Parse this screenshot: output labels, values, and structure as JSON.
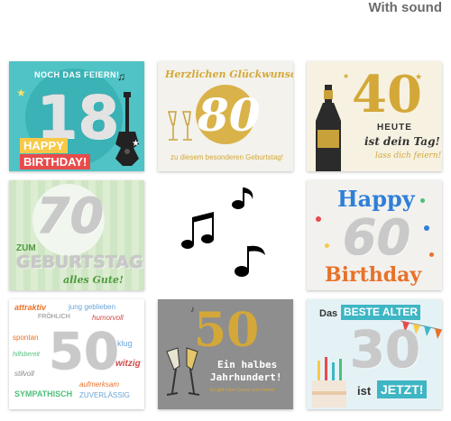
{
  "header": {
    "badge": "With sound"
  },
  "cards": [
    {
      "id": "18",
      "top": "NOCH DAS FEIERN!",
      "number": "18",
      "line1": "HAPPY",
      "line2": "BIRTHDAY!"
    },
    {
      "id": "80",
      "top": "Herzlichen Glückwunsch",
      "number": "80",
      "bottom": "zu diesem besonderen Geburtstag!"
    },
    {
      "id": "40",
      "number": "40",
      "line1": "HEUTE",
      "line2": "ist dein Tag!",
      "line3": "lass dich feiern!"
    },
    {
      "id": "70",
      "number": "70",
      "line1": "ZUM",
      "line2": "GEBURTSTAG",
      "line3": "alles Gute!"
    },
    {
      "id": "60",
      "line1": "Happy",
      "number": "60",
      "line2": "Birthday"
    },
    {
      "id": "50a",
      "number": "50",
      "words": [
        "attraktiv",
        "jung geblieben",
        "FRÖHLICH",
        "humorvoll",
        "spontan",
        "hilfsbereit",
        "klug",
        "witzig",
        "stilvoll",
        "aufmerksam",
        "SYMPATHISCH",
        "ZUVERLÄSSIG"
      ]
    },
    {
      "id": "50b",
      "number": "50",
      "line1": "Ein halbes",
      "line2": "Jahrhundert!",
      "line3": "Es gibt einen Grund zum Feiern!"
    },
    {
      "id": "30",
      "line1": "Das",
      "line2": "BESTE ALTER",
      "number": "30",
      "line3": "ist",
      "line4": "JETZT!"
    }
  ]
}
